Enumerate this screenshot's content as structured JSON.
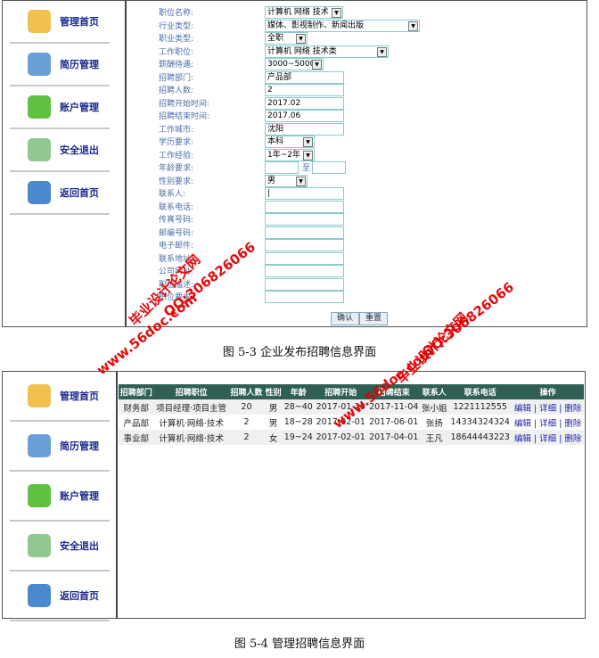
{
  "figure1": {
    "sidebar": [
      {
        "label": "管理首页",
        "icon": "magnifier-folder-icon",
        "color": "#f0c050"
      },
      {
        "label": "简历管理",
        "icon": "edit-document-icon",
        "color": "#6aa0d8"
      },
      {
        "label": "账户管理",
        "icon": "add-folder-icon",
        "color": "#60c040"
      },
      {
        "label": "安全退出",
        "icon": "clipboard-icon",
        "color": "#90c890"
      },
      {
        "label": "返回首页",
        "icon": "globe-arrow-icon",
        "color": "#4a88d0"
      }
    ],
    "form": [
      {
        "label": "职位名称:",
        "type": "select",
        "value": "计算机 网络 技术",
        "w": 84
      },
      {
        "label": "行业类型:",
        "type": "select",
        "value": "媒体、影视制作、新闻出版",
        "w": 170
      },
      {
        "label": "职业类型:",
        "type": "select",
        "value": "全职",
        "w": 44
      },
      {
        "label": "工作职位:",
        "type": "select",
        "value": "计算机 网络 技术类",
        "w": 135
      },
      {
        "label": "薪酬待遇:",
        "type": "select",
        "value": "3000~5000",
        "w": 62
      },
      {
        "label": "招聘部门:",
        "type": "input",
        "value": "产品部",
        "w": 85
      },
      {
        "label": "招聘人数:",
        "type": "input",
        "value": "2",
        "w": 85
      },
      {
        "label": "招聘开始时间:",
        "type": "input",
        "value": "2017.02",
        "w": 85
      },
      {
        "label": "招聘结束时间:",
        "type": "input",
        "value": "2017.06",
        "w": 85
      },
      {
        "label": "工作城市:",
        "type": "input",
        "value": "沈阳",
        "w": 85
      },
      {
        "label": "学历要求:",
        "type": "select",
        "value": "本科",
        "w": 52
      },
      {
        "label": "工作经验:",
        "type": "select",
        "value": "1年~2年",
        "w": 52
      },
      {
        "label": "年龄要求:",
        "type": "range",
        "value": "",
        "to": "至",
        "w": 34
      },
      {
        "label": "性别要求:",
        "type": "select",
        "value": "男",
        "w": 44
      },
      {
        "label": "联系人:",
        "type": "input",
        "value": "|",
        "w": 85
      },
      {
        "label": "联系电话:",
        "type": "input",
        "value": "",
        "w": 85
      },
      {
        "label": "传真号码:",
        "type": "input",
        "value": "",
        "w": 85
      },
      {
        "label": "邮编号码:",
        "type": "input",
        "value": "",
        "w": 85
      },
      {
        "label": "电子邮件:",
        "type": "input",
        "value": "",
        "w": 85
      },
      {
        "label": "联系地址:",
        "type": "input",
        "value": "",
        "w": 85
      },
      {
        "label": "公司网址:",
        "type": "input",
        "value": "",
        "w": 85
      },
      {
        "label": "职位描述:",
        "type": "input",
        "value": "",
        "w": 85
      },
      {
        "label": "职位要求:",
        "type": "input",
        "value": "",
        "w": 85
      }
    ],
    "confirm": "确认",
    "reset": "重置"
  },
  "caption1": "图 5-3  企业发布招聘信息界面",
  "figure2": {
    "sidebar": [
      {
        "label": "管理首页",
        "icon": "magnifier-folder-icon",
        "color": "#f0c050"
      },
      {
        "label": "简历管理",
        "icon": "edit-document-icon",
        "color": "#6aa0d8"
      },
      {
        "label": "账户管理",
        "icon": "add-folder-icon",
        "color": "#60c040"
      },
      {
        "label": "安全退出",
        "icon": "clipboard-icon",
        "color": "#90c890"
      },
      {
        "label": "返回首页",
        "icon": "globe-arrow-icon",
        "color": "#4a88d0"
      }
    ],
    "headers": [
      "招聘部门",
      "招聘职位",
      "招聘人数",
      "性别",
      "年龄",
      "招聘开始",
      "招聘结束",
      "联系人",
      "联系电话",
      "操作"
    ],
    "rows": [
      [
        "财务部",
        "项目经理·项目主管",
        "20",
        "男",
        "28~40",
        "2017-01-10",
        "2017-11-04",
        "张小姐",
        "1221112555"
      ],
      [
        "产品部",
        "计算机·网络·技术",
        "2",
        "男",
        "18~28",
        "2017-02-01",
        "2017-06-01",
        "张扬",
        "14334324324"
      ],
      [
        "事业部",
        "计算机·网络·技术",
        "2",
        "女",
        "19~24",
        "2017-02-01",
        "2017-04-01",
        "王凡",
        "18644443223"
      ]
    ],
    "actions": [
      "编辑",
      "详细",
      "删除"
    ],
    "header_color": "#2f5f55"
  },
  "caption2": "图 5-4  管理招聘信息界面",
  "watermarks": [
    "www.56doc.com",
    "毕业设计论文网",
    "QQ:306826066"
  ]
}
